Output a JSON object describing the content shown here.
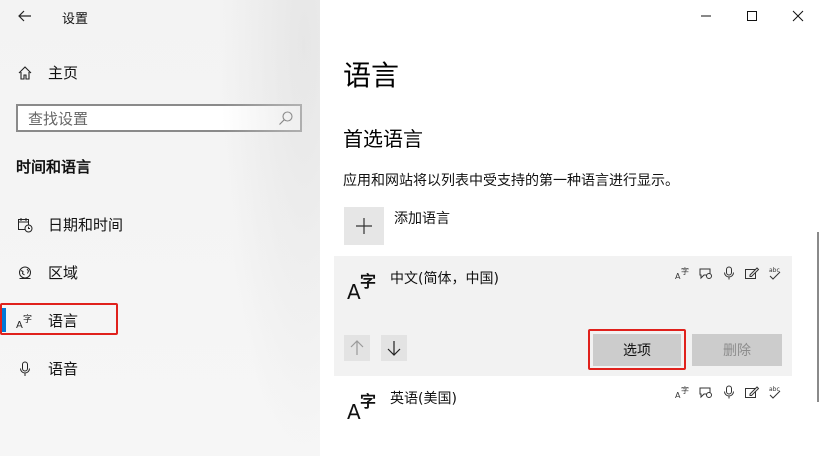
{
  "window": {
    "title": "设置"
  },
  "sidebar": {
    "home_label": "主页",
    "search_placeholder": "查找设置",
    "section_title": "时间和语言",
    "items": [
      {
        "label": "日期和时间",
        "icon": "calendar-clock-icon"
      },
      {
        "label": "区域",
        "icon": "globe-region-icon"
      },
      {
        "label": "语言",
        "icon": "language-icon",
        "active": true
      },
      {
        "label": "语音",
        "icon": "microphone-icon"
      }
    ]
  },
  "main": {
    "title": "语言",
    "subtitle": "首选语言",
    "description": "应用和网站将以列表中受支持的第一种语言进行显示。",
    "add_label": "添加语言",
    "languages": [
      {
        "name": "中文(简体，中国)"
      },
      {
        "name": "英语(美国)"
      }
    ],
    "options_label": "选项",
    "remove_label": "删除"
  },
  "colors": {
    "accent": "#0078d7",
    "highlight": "#e0211c"
  }
}
